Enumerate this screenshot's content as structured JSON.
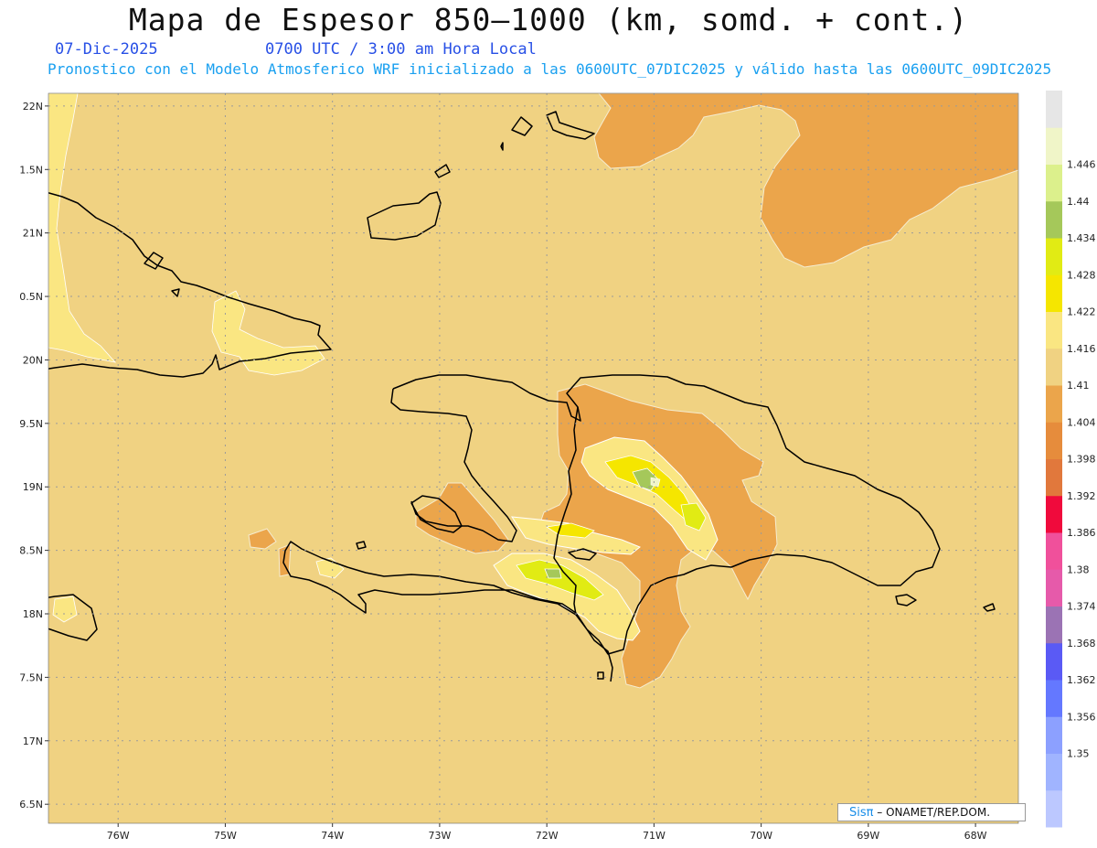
{
  "title": "Mapa de Espesor 850–1000 (km, somd. + cont.)",
  "date_label": "07-Dic-2025",
  "utc_label": "0700 UTC / 3:00 am Hora Local",
  "model_label": "Pronostico con el Modelo Atmosferico WRF inicializado a las 0600UTC_07DIC2025 y válido hasta las  0600UTC_09DIC2025",
  "credit": {
    "logo": "Sisπ",
    "text": "– ONAMET/REP.DOM."
  },
  "map": {
    "lon_range": [
      -76.65,
      -67.6
    ],
    "lat_range": [
      16.35,
      22.1
    ],
    "lat_ticks": [
      {
        "value": 22,
        "label": "22N"
      },
      {
        "value": 21.5,
        "label": "1.5N"
      },
      {
        "value": 21,
        "label": "21N"
      },
      {
        "value": 20.5,
        "label": "0.5N"
      },
      {
        "value": 20,
        "label": "20N"
      },
      {
        "value": 19.5,
        "label": "9.5N"
      },
      {
        "value": 19,
        "label": "19N"
      },
      {
        "value": 18.5,
        "label": "8.5N"
      },
      {
        "value": 18,
        "label": "18N"
      },
      {
        "value": 17.5,
        "label": "7.5N"
      },
      {
        "value": 17,
        "label": "17N"
      },
      {
        "value": 16.5,
        "label": "6.5N"
      }
    ],
    "lon_ticks": [
      {
        "value": -76,
        "label": "76W"
      },
      {
        "value": -75,
        "label": "75W"
      },
      {
        "value": -74,
        "label": "74W"
      },
      {
        "value": -73,
        "label": "73W"
      },
      {
        "value": -72,
        "label": "72W"
      },
      {
        "value": -71,
        "label": "71W"
      },
      {
        "value": -70,
        "label": "70W"
      },
      {
        "value": -69,
        "label": "69W"
      },
      {
        "value": -68,
        "label": "68W"
      }
    ]
  },
  "colorbar": {
    "levels": [
      "1.446",
      "1.44",
      "1.434",
      "1.428",
      "1.422",
      "1.416",
      "1.41",
      "1.404",
      "1.398",
      "1.392",
      "1.386",
      "1.38",
      "1.374",
      "1.368",
      "1.362",
      "1.356",
      "1.35"
    ],
    "colors": [
      "#bcc8ff",
      "#a0b4ff",
      "#8ca0ff",
      "#6478ff",
      "#5a5af5",
      "#9b73b4",
      "#e65aaa",
      "#f0509b",
      "#f00a3c",
      "#e1783c",
      "#e68c3c",
      "#eba54b",
      "#f0d282",
      "#fae682",
      "#f5e600",
      "#e1eb14",
      "#a5c85a",
      "#dcf08c",
      "#f0f5c8",
      "#e6e6e6"
    ]
  }
}
